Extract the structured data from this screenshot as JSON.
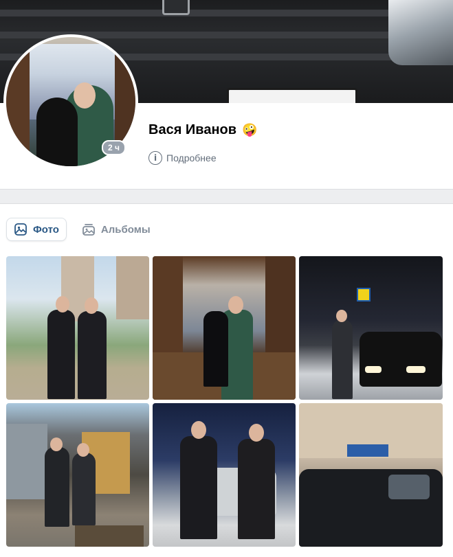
{
  "profile": {
    "name": "Вася Иванов",
    "status_emoji": "🤪",
    "online_badge": "2 ч",
    "more_label": "Подробнее"
  },
  "photos_section": {
    "tabs": [
      {
        "label": "Фото",
        "icon": "photo-icon",
        "active": true
      },
      {
        "label": "Альбомы",
        "icon": "albums-icon",
        "active": false
      }
    ],
    "photos": [
      {
        "name": "photo-two-men-field"
      },
      {
        "name": "photo-couple-restaurant"
      },
      {
        "name": "photo-man-car-night"
      },
      {
        "name": "photo-two-men-garage"
      },
      {
        "name": "photo-two-men-car-evening"
      },
      {
        "name": "photo-man-car-street"
      }
    ]
  },
  "colors": {
    "accent": "#2a5885",
    "muted": "#818c99",
    "background": "#edeef0",
    "badge": "#99a2ad"
  }
}
